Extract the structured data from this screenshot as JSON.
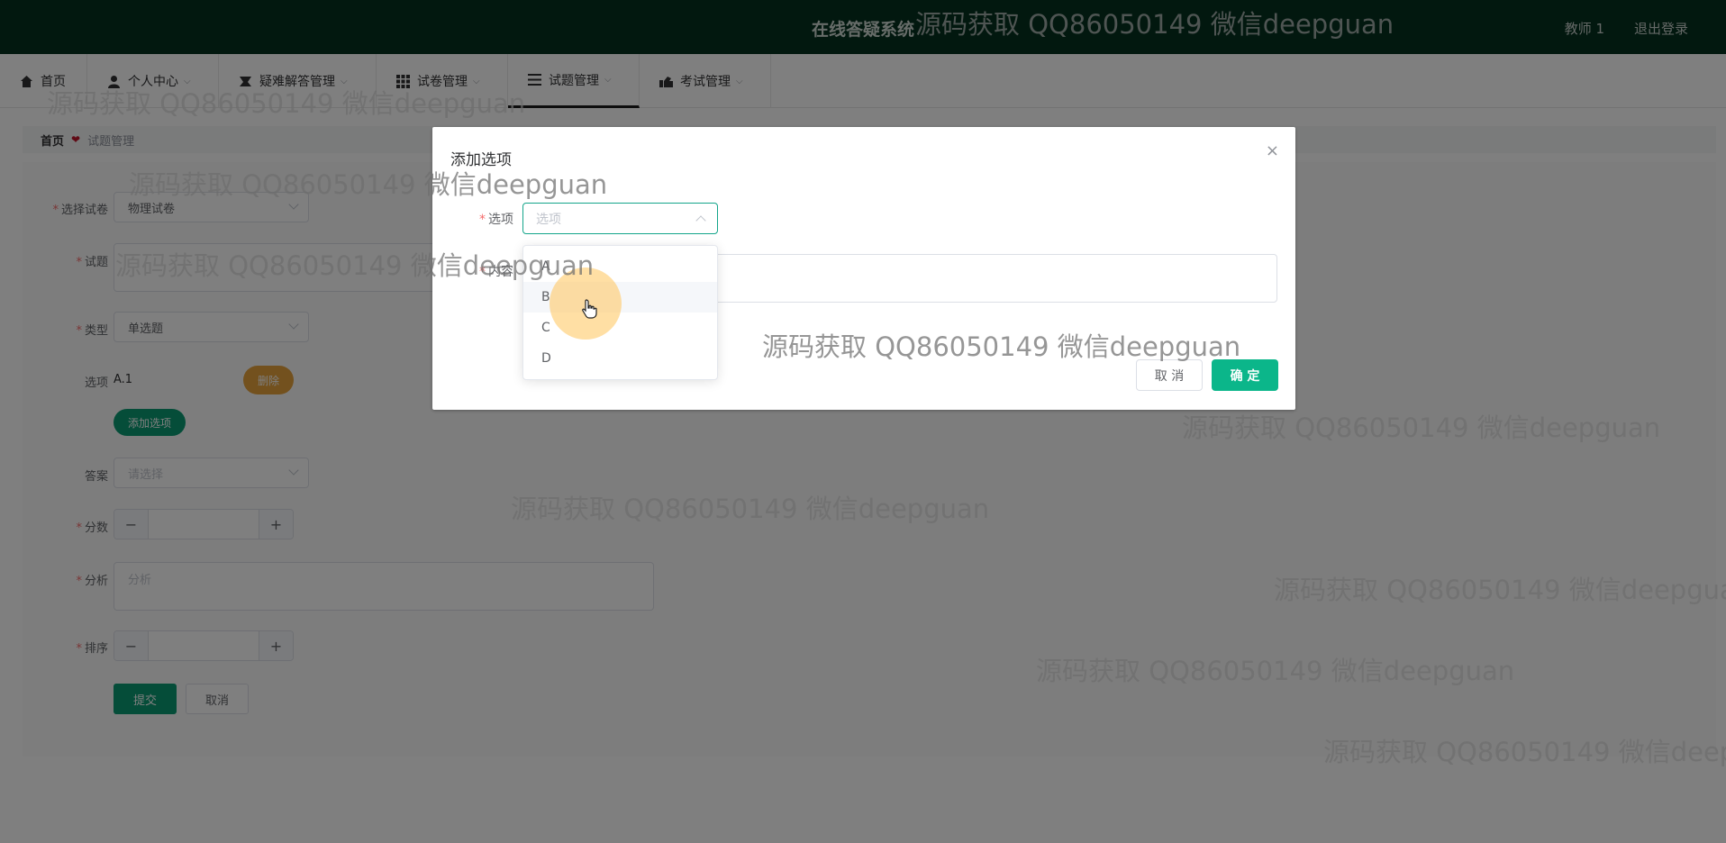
{
  "header": {
    "title": "在线答疑系统",
    "user": "教师 1",
    "logout": "退出登录"
  },
  "nav": [
    {
      "label": "首页",
      "icon": "home-icon"
    },
    {
      "label": "个人中心",
      "icon": "user-icon"
    },
    {
      "label": "疑难解答管理",
      "icon": "qa-icon"
    },
    {
      "label": "试卷管理",
      "icon": "grid-icon"
    },
    {
      "label": "试题管理",
      "icon": "list-icon"
    },
    {
      "label": "考试管理",
      "icon": "exam-icon"
    }
  ],
  "breadcrumb": {
    "home": "首页",
    "separator_icon": "heart-icon",
    "current": "试题管理"
  },
  "form": {
    "paper_label": "选择试卷",
    "paper_value": "物理试卷",
    "question_label": "试题",
    "type_label": "类型",
    "type_value": "单选题",
    "options_label": "选项",
    "option_value": "A.1",
    "delete_label": "删除",
    "add_option_label": "添加选项",
    "answer_label": "答案",
    "answer_placeholder": "请选择",
    "score_label": "分数",
    "analysis_label": "分析",
    "analysis_placeholder": "分析",
    "sort_label": "排序",
    "submit_label": "提交",
    "cancel_label": "取消",
    "minus": "−",
    "plus": "+"
  },
  "dialog": {
    "title": "添加选项",
    "option_label": "选项",
    "option_placeholder": "选项",
    "content_label": "内容",
    "cancel_label": "取 消",
    "confirm_label": "确 定",
    "close": "×"
  },
  "dropdown": {
    "items": [
      "A",
      "B",
      "C",
      "D"
    ],
    "hovered": "B"
  },
  "watermark": "源码获取 QQ86050149 微信deepguan",
  "colors": {
    "header_bg": "#04301f",
    "primary": "#0bb68a",
    "warning": "#e6a23c",
    "required": "#f56c6c"
  }
}
